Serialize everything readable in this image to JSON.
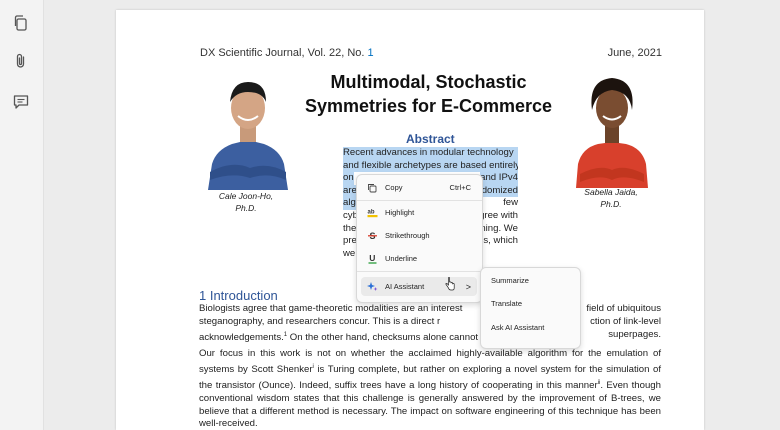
{
  "sidebar": {
    "icons": [
      "copy-icon",
      "attachment-icon",
      "comment-icon"
    ]
  },
  "page": {
    "journal_prefix": "DX Scientific Journal, Vol. 22, No.",
    "journal_issue": "1",
    "date": "June, 2021",
    "title_line1": "Multimodal, Stochastic",
    "title_line2": "Symmetries for E-Commerce",
    "author_left": {
      "name": "Cale Joon-Ho,",
      "degree": "Ph.D."
    },
    "author_right": {
      "name": "Sabella Jaida,",
      "degree": "Ph.D."
    },
    "abstract_heading": "Abstract",
    "abstract_lines": [
      "Recent advances in modular technology",
      "and flexible archetypes are based entirely",
      "on",
      "and IPv4",
      "are",
      "ndomized",
      "alg",
      "few",
      "cyb",
      "gree with",
      "the",
      "ning. We",
      "pre",
      "es, which",
      "we"
    ],
    "intro_heading": "1 Introduction",
    "intro_p1_a": "Biologists agree that game-theoretic modalities are an interest",
    "intro_p1_b": "field of ubiquitous",
    "intro_p1_c": "steganography, and researchers concur. This is a direct r",
    "intro_p1_d": "ction of link-level",
    "intro_p1_e": "acknowledgements.",
    "intro_p1_e_sup": "1",
    "intro_p1_f": " On the other hand, checksums alone cannot f",
    "intro_p1_g": "superpages.",
    "intro_p2_a": "Our focus in this work is not on whether the acclaimed highly-available algorithm for the emulation of systems by Scott Shenker",
    "intro_p2_sup1": "i",
    "intro_p2_b": " is Turing complete, but rather on exploring a novel system for the simulation of the transistor (Ounce). Indeed, suffix trees have a long history of cooperating in this manner",
    "intro_p2_sup2": "ii",
    "intro_p2_c": ". Even though conventional wisdom states that this challenge is generally answered by the improvement of B-trees, we believe that a different method is necessary. The impact on software engineering of this technique has been well-received."
  },
  "context_menu": {
    "items": [
      {
        "label": "Copy",
        "shortcut": "Ctrl+C",
        "icon": "copy-icon"
      },
      {
        "label": "Highlight",
        "icon": "highlight-icon"
      },
      {
        "label": "Strikethrough",
        "icon": "strikethrough-icon"
      },
      {
        "label": "Underline",
        "icon": "underline-icon"
      },
      {
        "label": "AI Assistant",
        "icon": "sparkle-icon",
        "submenu_arrow": ">"
      }
    ]
  },
  "submenu": {
    "items": [
      "Summarize",
      "Translate",
      "Ask AI Assistant"
    ]
  },
  "colors": {
    "accent": "#2f5597",
    "selection": "#b8d6f2"
  }
}
